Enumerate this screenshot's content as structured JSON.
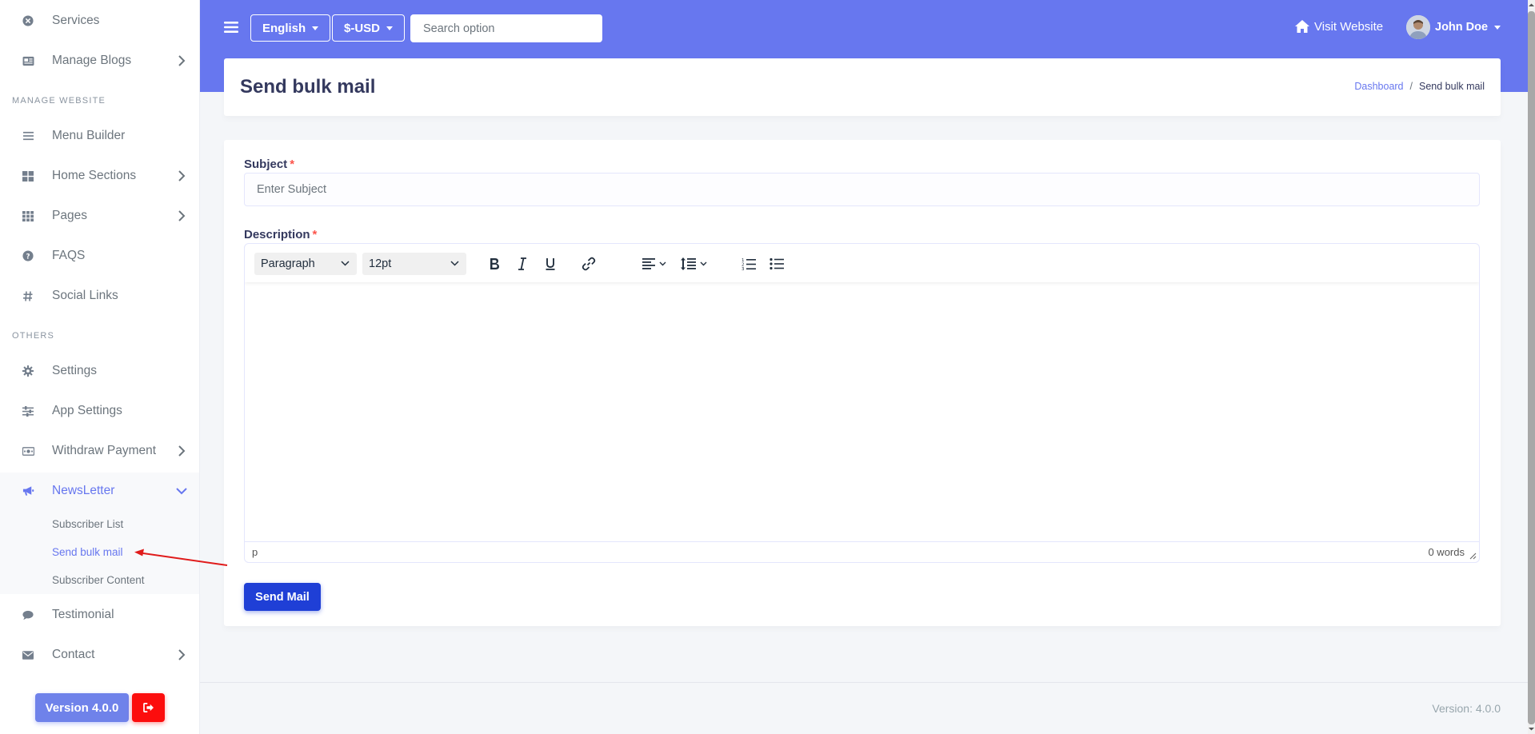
{
  "sidebar": {
    "items": [
      {
        "label": "Services",
        "icon": "times-circle-icon"
      },
      {
        "label": "Manage Blogs",
        "icon": "newspaper-icon"
      },
      {
        "label": "Menu Builder",
        "icon": "bars-icon"
      },
      {
        "label": "Home Sections",
        "icon": "grid-icon"
      },
      {
        "label": "Pages",
        "icon": "th-icon"
      },
      {
        "label": "FAQS",
        "icon": "question-circle-icon"
      },
      {
        "label": "Social Links",
        "icon": "hashtag-icon"
      },
      {
        "label": "Settings",
        "icon": "cog-icon"
      },
      {
        "label": "App Settings",
        "icon": "sliders-icon"
      },
      {
        "label": "Withdraw Payment",
        "icon": "money-icon"
      },
      {
        "label": "NewsLetter",
        "icon": "bullhorn-icon"
      },
      {
        "label": "Testimonial",
        "icon": "comment-icon"
      },
      {
        "label": "Contact",
        "icon": "envelope-icon"
      }
    ],
    "headers": {
      "manage_website": "MANAGE WEBSITE",
      "others": "OTHERS"
    },
    "newsletter_sub": [
      {
        "label": "Subscriber List"
      },
      {
        "label": "Send bulk mail"
      },
      {
        "label": "Subscriber Content"
      }
    ],
    "version_label": "Version 4.0.0"
  },
  "topbar": {
    "language": "English",
    "currency": "$-USD",
    "search_placeholder": "Search option",
    "visit_website": "Visit Website",
    "user_name": "John Doe"
  },
  "header": {
    "title": "Send bulk mail",
    "breadcrumb": [
      "Dashboard",
      "Send bulk mail"
    ]
  },
  "form": {
    "subject_label": "Subject",
    "subject_placeholder": "Enter Subject",
    "description_label": "Description",
    "required_mark": "*",
    "editor": {
      "block_format": "Paragraph",
      "font_size": "12pt",
      "status_path": "p",
      "word_count": "0 words"
    },
    "submit_label": "Send Mail"
  },
  "footer": {
    "version": "Version: 4.0.0"
  },
  "colors": {
    "primary": "#6777ef",
    "send_button": "#1f3fd6",
    "logout_button": "#fc0d0d",
    "required": "#fc544b",
    "annotation_arrow": "#e01b1b"
  }
}
